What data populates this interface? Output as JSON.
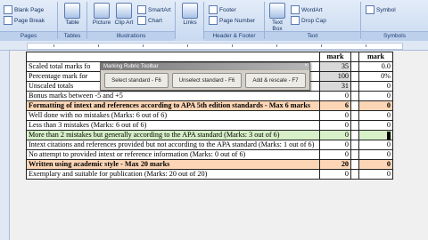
{
  "ribbon": {
    "blank_page": "Blank Page",
    "page_break": "Page Break",
    "table": "Table",
    "picture": "Picture",
    "clip_art": "Clip Art",
    "smartart": "SmartArt",
    "chart": "Chart",
    "links": "Links",
    "footer": "Footer",
    "page_number": "Page Number",
    "text_box": "Text Box",
    "wordart": "WordArt",
    "drop_cap": "Drop Cap",
    "symbol": "Symbol",
    "groups": {
      "pages": "Pages",
      "tables": "Tables",
      "illustrations": "Illustrations",
      "header_footer": "Header & Footer",
      "text": "Text",
      "symbols": "Symbols"
    }
  },
  "toolbar": {
    "title": "Marking Rubric Toolbar",
    "close": "×",
    "select_standard": "Select standard - F6",
    "unselect_standard": "Unselect standard - F6",
    "add_rescale": "Add & rescale - F7"
  },
  "table": {
    "header": {
      "mark1": "mark",
      "mark2": "mark"
    },
    "rows": [
      {
        "text": "Scaled total marks fo",
        "m1": "35",
        "m2": "0.0"
      },
      {
        "text": "Percentage mark for",
        "m1": "100",
        "m2": "0%"
      },
      {
        "text": "Unscaled totals",
        "m1": "31",
        "m2": "0"
      },
      {
        "text": "Bonus marks between -5 and +5",
        "m1": "0",
        "m2": "0"
      },
      {
        "text": "Formatting of intext and references according to APA 5th edition standards - Max 6 marks",
        "m1": "6",
        "m2": "0"
      },
      {
        "text": "Well done with no mistakes (Marks: 6 out of 6)",
        "m1": "0",
        "m2": "0"
      },
      {
        "text": "Less than 3 mistakes (Marks: 6 out of 6)",
        "m1": "0",
        "m2": "0"
      },
      {
        "text": "More than 2 mistakes but generally according to the APA standard (Marks: 3 out of 6)",
        "m1": "0",
        "m2": ""
      },
      {
        "text": "Intext citations and references provided but not according to the APA standard (Marks: 1 out of 6)",
        "m1": "0",
        "m2": "0"
      },
      {
        "text": "No attempt to provided intext or reference information (Marks: 0 out of 6)",
        "m1": "0",
        "m2": "0"
      },
      {
        "text": "Written using academic style - Max 20 marks",
        "m1": "20",
        "m2": "0"
      },
      {
        "text": "Exemplary and suitable for publication (Marks: 20 out of 20)",
        "m1": "0",
        "m2": "0"
      }
    ]
  }
}
